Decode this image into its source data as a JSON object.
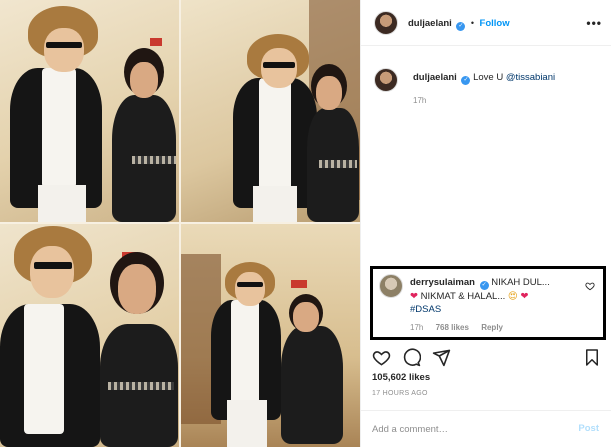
{
  "header": {
    "username": "duljaelani",
    "follow_separator": "•",
    "follow_label": "Follow",
    "more_icon": "more-dots-icon"
  },
  "caption": {
    "username": "duljaelani",
    "text_prefix": "Love U",
    "mention": "@tissabiani",
    "time": "17h"
  },
  "comment": {
    "username": "derrysulaiman",
    "line1": "NIKAH DUL...",
    "line2_text": "NIKMAT & HALAL...",
    "hashtag": "#DSAS",
    "time": "17h",
    "likes": "768 likes",
    "reply": "Reply"
  },
  "actions": {
    "like_icon": "heart-icon",
    "comment_icon": "comment-bubble-icon",
    "share_icon": "paper-plane-icon",
    "save_icon": "bookmark-icon"
  },
  "post": {
    "likes": "105,602 likes",
    "time": "17 HOURS AGO"
  },
  "add_comment": {
    "placeholder": "Add a comment…",
    "post_label": "Post"
  },
  "colors": {
    "link_blue": "#0095f6",
    "verified_blue": "#3897f0",
    "heart_red": "#e0245e",
    "muted": "#8e8e8e"
  }
}
